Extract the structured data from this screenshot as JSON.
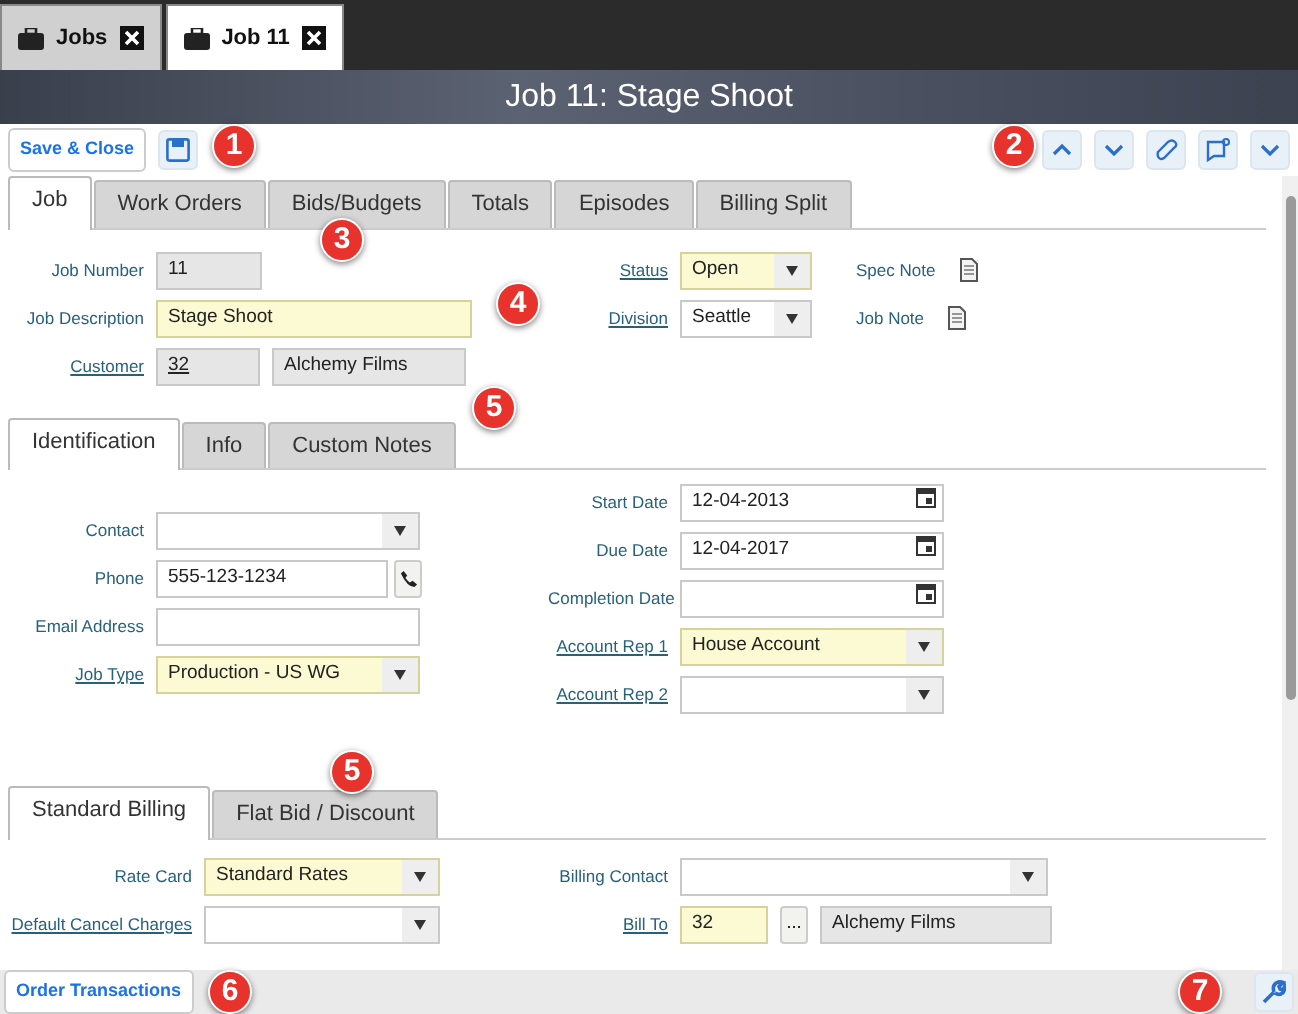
{
  "doc_tabs": [
    {
      "label": "Jobs",
      "selected": false
    },
    {
      "label": "Job 11",
      "selected": true
    }
  ],
  "title": "Job 11: Stage Shoot",
  "toolbar": {
    "save_close": "Save & Close"
  },
  "tabs": [
    {
      "label": "Job",
      "selected": true
    },
    {
      "label": "Work Orders",
      "selected": false
    },
    {
      "label": "Bids/Budgets",
      "selected": false
    },
    {
      "label": "Totals",
      "selected": false
    },
    {
      "label": "Episodes",
      "selected": false
    },
    {
      "label": "Billing Split",
      "selected": false
    }
  ],
  "job": {
    "left": [
      {
        "label": "Job Number",
        "link": false,
        "kind": "text",
        "value": "11",
        "required": false,
        "readonly": true
      },
      {
        "label": "Job Description",
        "link": false,
        "kind": "text",
        "value": "Stage Shoot",
        "required": true,
        "readonly": false
      },
      {
        "label": "Customer",
        "link": true,
        "kind": "pair",
        "values": [
          {
            "text": "32",
            "link": true,
            "required": false,
            "readonly": true
          },
          {
            "text": "Alchemy Films",
            "link": false,
            "required": false,
            "readonly": true
          }
        ]
      }
    ],
    "right": [
      {
        "label": "Status",
        "link": true,
        "kind": "select",
        "value": "Open",
        "required": true,
        "readonly": false,
        "note": "Spec Note"
      },
      {
        "label": "Division",
        "link": true,
        "kind": "select",
        "value": "Seattle",
        "required": false,
        "readonly": false,
        "note": "Job Note"
      }
    ]
  },
  "sections": [
    {
      "tabs": [
        {
          "label": "Identification",
          "selected": true
        },
        {
          "label": "Info",
          "selected": false
        },
        {
          "label": "Custom Notes",
          "selected": false
        }
      ],
      "left": [
        {
          "label": "Contact",
          "link": false,
          "kind": "select",
          "required": false,
          "readonly": false
        },
        {
          "label": "Phone",
          "link": false,
          "kind": "phone",
          "value": "555-123-1234",
          "required": false,
          "readonly": false
        },
        {
          "label": "Email Address",
          "link": false,
          "kind": "text",
          "required": false,
          "readonly": false
        },
        {
          "label": "Job Type",
          "link": true,
          "kind": "select",
          "value": "Production - US WG",
          "required": true,
          "readonly": false
        }
      ],
      "right": [
        {
          "label": "Start Date",
          "link": false,
          "kind": "date",
          "value": "12-04-2013",
          "required": false,
          "readonly": false
        },
        {
          "label": "Due Date",
          "link": false,
          "kind": "date",
          "value": "12-04-2017",
          "required": false,
          "readonly": false
        },
        {
          "label": "Completion Date",
          "link": false,
          "kind": "date",
          "required": false,
          "readonly": false
        },
        {
          "label": "Account Rep 1",
          "link": true,
          "kind": "select",
          "value": "House Account",
          "required": true,
          "readonly": false
        },
        {
          "label": "Account Rep 2",
          "link": true,
          "kind": "select",
          "required": false,
          "readonly": false
        }
      ]
    },
    {
      "tabs": [
        {
          "label": "Standard Billing",
          "selected": true
        },
        {
          "label": "Flat Bid / Discount",
          "selected": false
        }
      ],
      "left": [
        {
          "label": "Rate Card",
          "link": false,
          "kind": "select",
          "value": "Standard Rates",
          "required": true,
          "readonly": false
        },
        {
          "label": "Default Cancel Charges",
          "link": true,
          "kind": "select",
          "required": false,
          "readonly": false
        }
      ],
      "right": [
        {
          "label": "Billing Contact",
          "link": false,
          "kind": "select",
          "required": false,
          "readonly": false
        },
        {
          "label": "Bill To",
          "link": true,
          "kind": "lookup",
          "button": "...",
          "values": [
            {
              "text": "32",
              "link": false,
              "required": true,
              "readonly": false
            },
            {
              "text": "Alchemy Films",
              "link": false,
              "required": false,
              "readonly": true
            }
          ]
        }
      ]
    }
  ],
  "footer": {
    "button": "Order Transactions"
  },
  "callouts": [
    "1",
    "2",
    "3",
    "4",
    "5",
    "5",
    "6",
    "7"
  ]
}
